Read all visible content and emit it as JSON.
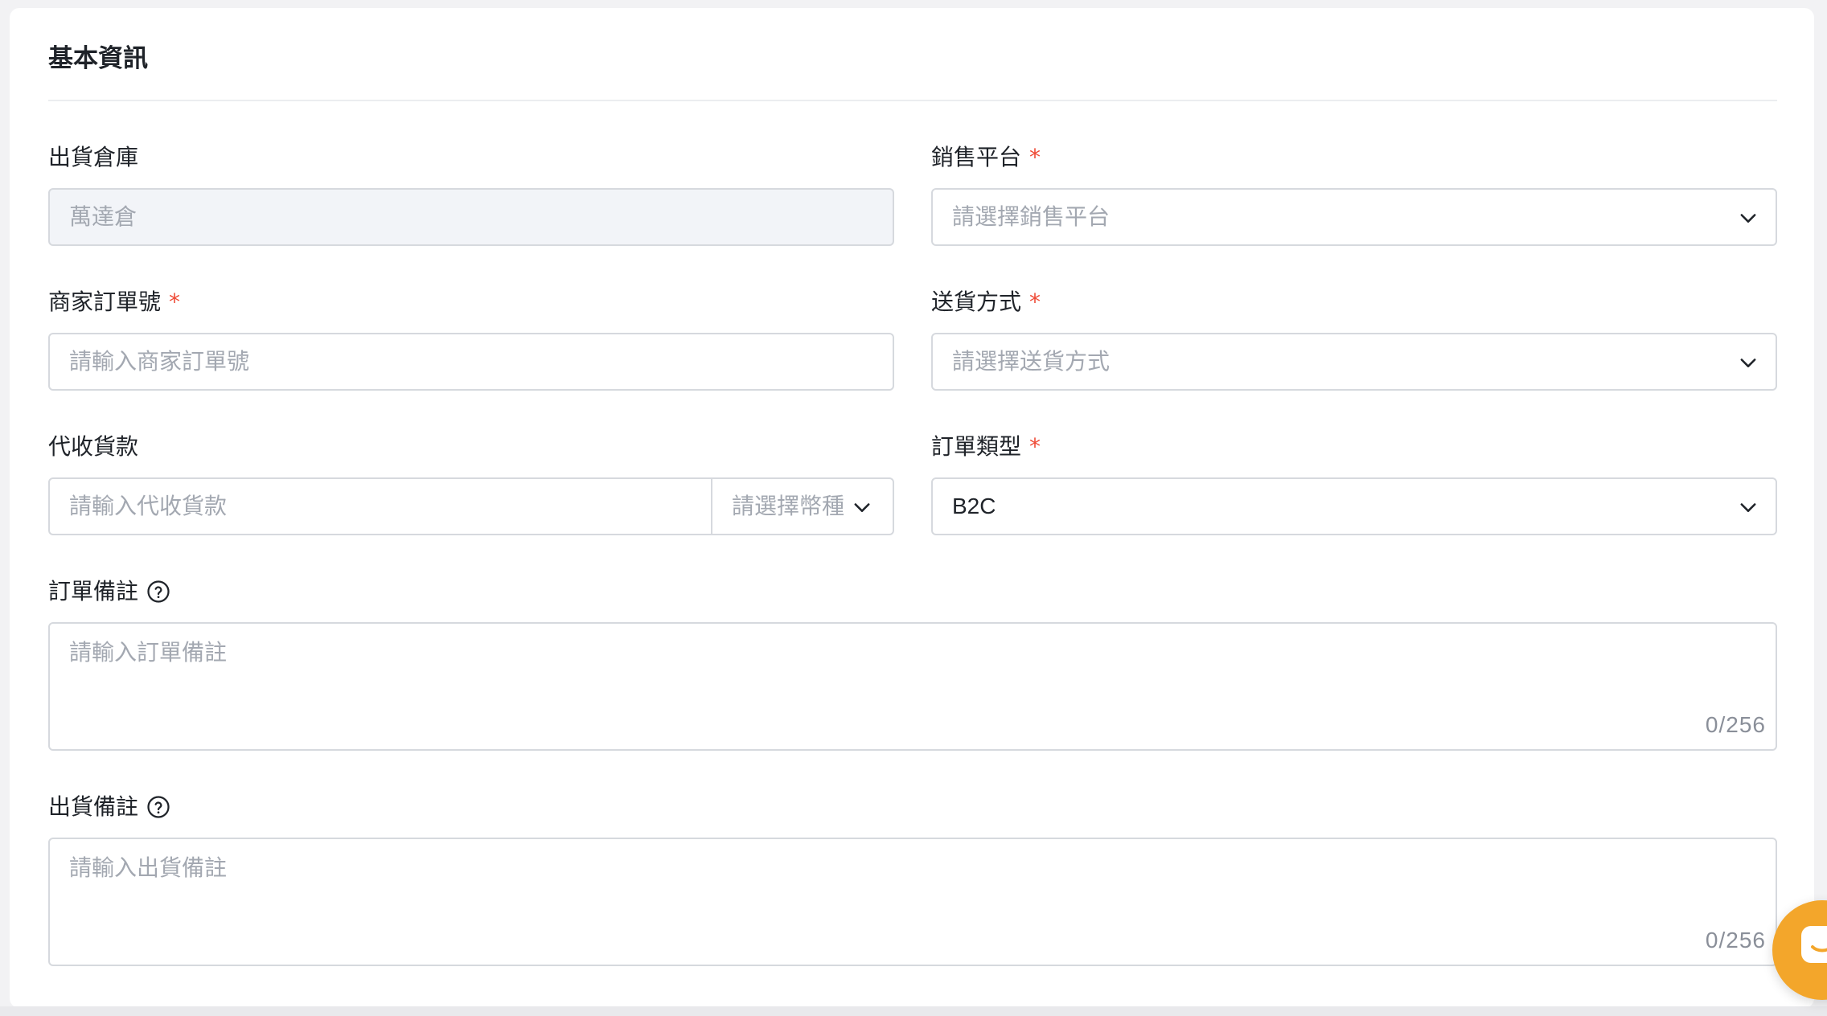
{
  "section": {
    "title": "基本資訊"
  },
  "warehouse": {
    "label": "出貨倉庫",
    "value": "萬達倉"
  },
  "platform": {
    "label": "銷售平台",
    "required": "*",
    "placeholder": "請選擇銷售平台"
  },
  "merchant_order": {
    "label": "商家訂單號",
    "required": "*",
    "placeholder": "請輸入商家訂單號"
  },
  "delivery": {
    "label": "送貨方式",
    "required": "*",
    "placeholder": "請選擇送貨方式"
  },
  "cod": {
    "label": "代收貨款",
    "placeholder": "請輸入代收貨款",
    "currency_placeholder": "請選擇幣種"
  },
  "order_type": {
    "label": "訂單類型",
    "required": "*",
    "value": "B2C"
  },
  "order_note": {
    "label": "訂單備註",
    "placeholder": "請輸入訂單備註",
    "counter": "0/256"
  },
  "ship_note": {
    "label": "出貨備註",
    "placeholder": "請輸入出貨備註",
    "counter": "0/256"
  },
  "icons": {
    "help": "question-circle-icon",
    "dropdown": "chevron-down-icon",
    "chat": "chat-icon"
  },
  "colors": {
    "required": "#ef4b37",
    "chat_button": "#f3a62b",
    "border": "#d6d9de",
    "placeholder": "#a3a8b1",
    "disabled_bg": "#f2f4f8"
  }
}
